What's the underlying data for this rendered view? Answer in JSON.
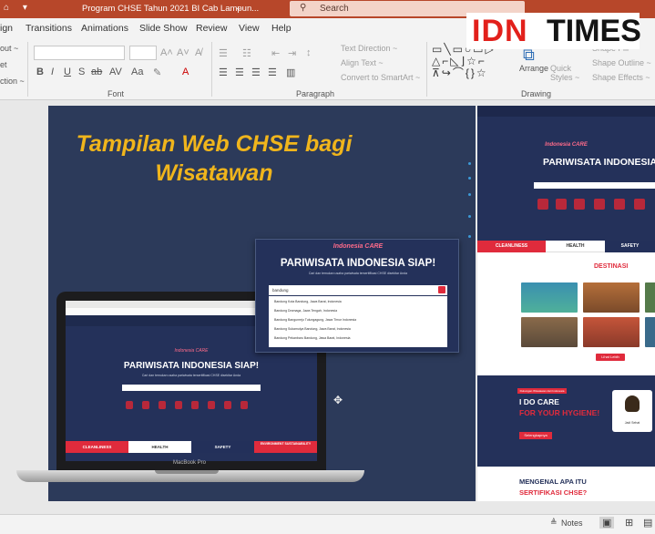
{
  "titlebar": {
    "doc_title": "Program CHSE Tahun 2021 BI Cab Lampun...",
    "search_placeholder": "Search"
  },
  "menu": {
    "items": [
      "ign",
      "Transitions",
      "Animations",
      "Slide Show",
      "Review",
      "View",
      "Help"
    ]
  },
  "ribbon": {
    "left_labels": [
      "out ~",
      "et",
      "ction ~"
    ],
    "font_group_label": "Font",
    "paragraph_group_label": "Paragraph",
    "drawing_group_label": "Drawing",
    "text_direction": "Text Direction ~",
    "align_text": "Align Text ~",
    "convert_smartart": "Convert to SmartArt ~",
    "arrange": "Arrange",
    "quick_styles": "Quick Styles ~",
    "shape_fill": "Shape Fill ~",
    "shape_outline": "Shape Outline ~",
    "shape_effects": "Shape Effects ~"
  },
  "logo": {
    "idn": "IDN",
    "times": "TIMES"
  },
  "slide": {
    "title_line1": "Tampilan Web CHSE bagi",
    "title_line2": "Wisatawan"
  },
  "popup": {
    "brand": "Indonesia CARE",
    "headline": "PARIWISATA INDONESIA SIAP!",
    "subtitle": "Cari dan temukan usaha pariwisata tersertifikasi CHSE disekitar Anda",
    "search_value": "bandung",
    "results": [
      "Bandung Kota Bandung, Jawa Barat, Indonesia",
      "Bandung Dramaga, Jawa Tengah, Indonesia",
      "Bandung Bangunrejo Tulungagung, Jawa Timur Indonesia",
      "Bandung Sukamulya Bandung, Jawa Barat, Indonesia",
      "Bandung Pekanbaru Bandung, Jawa Barat, Indonesia"
    ]
  },
  "laptop": {
    "brand_label": "Indonesia CARE",
    "headline": "PARIWISATA INDONESIA SIAP!",
    "subtitle": "Cari dan temukan usaha pariwisata tersertifikasi CHSE disekitar Anda",
    "tabs": [
      "CLEANLINESS",
      "HEALTH",
      "SAFETY",
      "ENVIRONMENT SUSTAINABILITY"
    ],
    "model": "MacBook Pro"
  },
  "website": {
    "brand": "Indonesia CARE",
    "headline": "PARIWISATA INDONESIA SIAP!",
    "tabs": [
      "CLEANLINESS",
      "HEALTH",
      "SAFETY"
    ],
    "destinasi_title": "DESTINASI",
    "cta_button": "Lihat Lebih",
    "care_badge": "Dukungan Wisatawan dari Indonesia",
    "care_line1": "I DO CARE",
    "care_line2": "FOR YOUR HYGIENE!",
    "care_button": "Selengkapnya",
    "mask_label": "Jadi Sehat",
    "faq_line1": "MENGENAL APA ITU",
    "faq_line2": "SERTIFIKASI CHSE?"
  },
  "statusbar": {
    "notes": "Notes"
  },
  "colors": {
    "accent_red": "#b7472a",
    "slide_bg": "#2c3a5a",
    "title_yellow": "#f0b51c",
    "brand_red": "#e02b3c"
  }
}
